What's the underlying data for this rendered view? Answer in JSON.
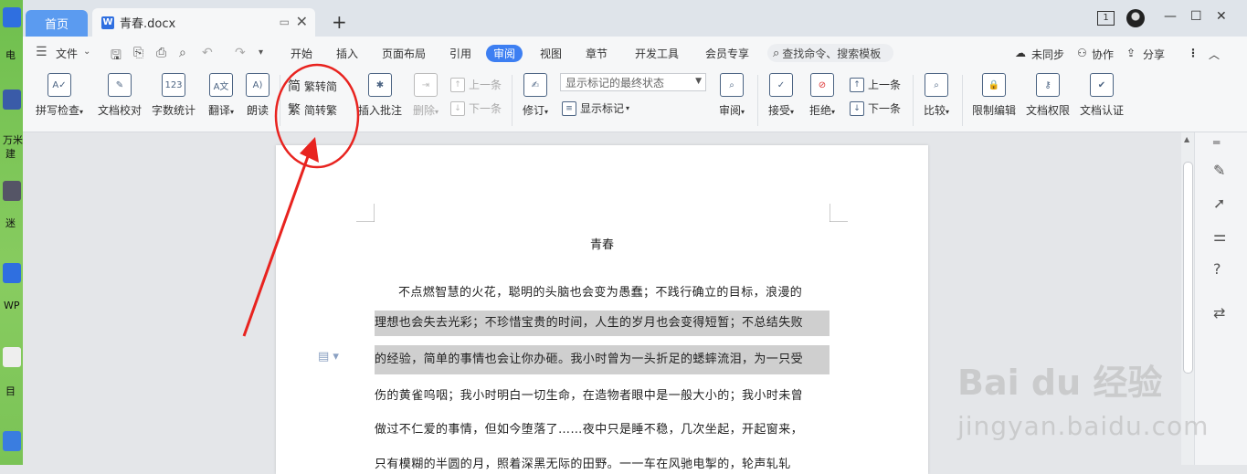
{
  "desktop": {
    "labels": [
      "电",
      "万米",
      "建",
      "迷",
      "WP",
      "目"
    ]
  },
  "tabs": {
    "home": "首页",
    "doc": "青春.docx"
  },
  "window": {
    "badge": "1"
  },
  "menu": {
    "file": "文件",
    "items": [
      "开始",
      "插入",
      "页面布局",
      "引用",
      "审阅",
      "视图",
      "章节",
      "开发工具",
      "会员专享"
    ],
    "active": "审阅",
    "search": "查找命令、搜索模板",
    "unsync": "未同步",
    "collab": "协作",
    "share": "分享"
  },
  "ribbon": {
    "spell": "拼写检查",
    "proof": "文档校对",
    "count": "字数统计",
    "translate": "翻译",
    "read": "朗读",
    "t2s": "繁转简",
    "s2t": "简转繁",
    "insert_comment": "插入批注",
    "delete": "删除",
    "prev": "上一条",
    "next": "下一条",
    "revise": "修订",
    "markup_mode": "显示标记的最终状态",
    "show_markup": "显示标记",
    "review": "审阅",
    "accept": "接受",
    "reject": "拒绝",
    "prev2": "上一条",
    "next2": "下一条",
    "compare": "比较",
    "restrict": "限制编辑",
    "rights": "文档权限",
    "certify": "文档认证"
  },
  "document": {
    "title": "青春",
    "lines": [
      "不点燃智慧的火花，聪明的头脑也会变为愚蠢；不践行确立的目标，浪漫的",
      "理想也会失去光彩；不珍惜宝贵的时间，人生的岁月也会变得短暂；不总结失败",
      "的经验，简单的事情也会让你办砸。我小时曾为一头折足的蟋蟀流泪，为一只受",
      "伤的黄雀呜咽；我小时明白一切生命，在造物者眼中是一般大小的；我小时未曾",
      "做过不仁爱的事情，但如今堕落了……夜中只是睡不稳，几次坐起，开起窗来，",
      "只有模糊的半圆的月，照着深黑无际的田野。一一车在风驰电掣的，轮声轧轧"
    ]
  },
  "watermark": {
    "logo": "Bai du 经验",
    "url": "jingyan.baidu.com"
  },
  "colors": {
    "accent": "#3d7ff2",
    "annotation": "#e8231f",
    "home_tab": "#5b9bf0"
  }
}
